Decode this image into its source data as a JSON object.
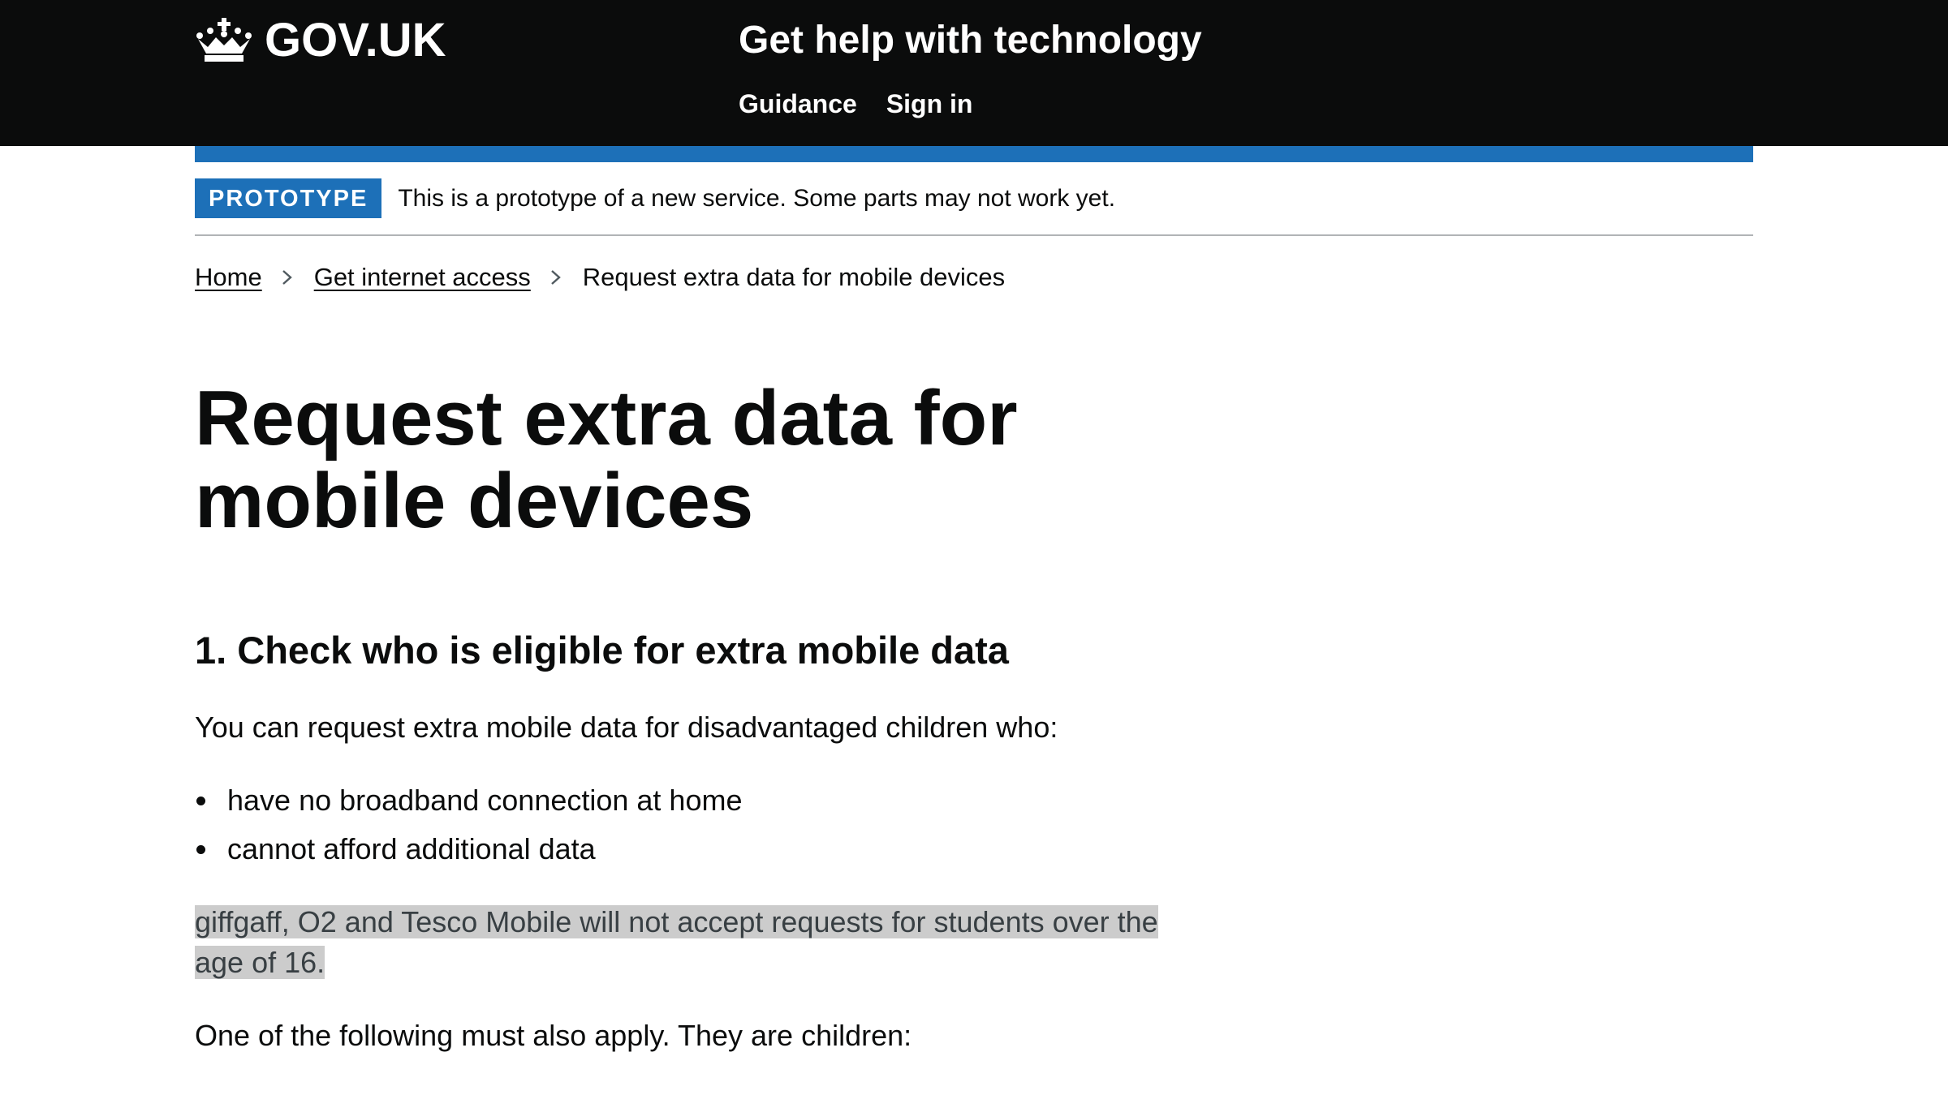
{
  "header": {
    "logo_text": "GOV.UK",
    "service_name": "Get help with technology",
    "nav": [
      {
        "label": "Guidance"
      },
      {
        "label": "Sign in"
      }
    ],
    "background_color": "#0b0c0c",
    "accent_color": "#1d70b8"
  },
  "phase_banner": {
    "tag": "PROTOTYPE",
    "text": "This is a prototype of a new service. Some parts may not work yet."
  },
  "breadcrumbs": [
    {
      "label": "Home"
    },
    {
      "label": "Get internet access"
    },
    {
      "label": "Request extra data for mobile devices"
    }
  ],
  "main": {
    "title": "Request extra data for mobile devices",
    "section_heading": "1. Check who is eligible for extra mobile data",
    "intro": "You can request extra mobile data for disadvantaged children who:",
    "criteria": [
      "have no broadband connection at home",
      "cannot afford additional data"
    ],
    "highlighted_note": "giffgaff, O2 and Tesco Mobile will not accept requests for students over the age of 16.",
    "also_apply": "One of the following must also apply. They are children:"
  },
  "icons": {
    "logo": "crown-icon",
    "breadcrumb_separator": "chevron-right-icon"
  }
}
